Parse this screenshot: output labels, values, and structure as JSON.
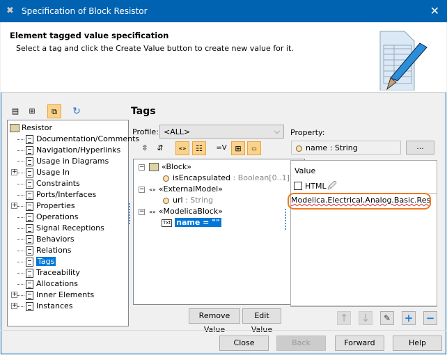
{
  "window": {
    "title": "Specification of Block Resistor",
    "close": "✕"
  },
  "header": {
    "title": "Element tagged value specification",
    "subtitle": "Select a tag and click the Create Value button to create new value for it."
  },
  "left_tree": {
    "root": "Resistor",
    "items": [
      {
        "label": "Documentation/Comments",
        "expandable": false
      },
      {
        "label": "Navigation/Hyperlinks",
        "expandable": false
      },
      {
        "label": "Usage in Diagrams",
        "expandable": false
      },
      {
        "label": "Usage In",
        "expandable": true
      },
      {
        "label": "Constraints",
        "expandable": false
      },
      {
        "label": "Ports/Interfaces",
        "expandable": false
      },
      {
        "label": "Properties",
        "expandable": true
      },
      {
        "label": "Operations",
        "expandable": false
      },
      {
        "label": "Signal Receptions",
        "expandable": false
      },
      {
        "label": "Behaviors",
        "expandable": false
      },
      {
        "label": "Relations",
        "expandable": false
      },
      {
        "label": "Tags",
        "expandable": false,
        "selected": true
      },
      {
        "label": "Traceability",
        "expandable": false
      },
      {
        "label": "Allocations",
        "expandable": false
      },
      {
        "label": "Inner Elements",
        "expandable": true
      },
      {
        "label": "Instances",
        "expandable": true
      }
    ]
  },
  "tags": {
    "title": "Tags",
    "profile_label": "Profile:",
    "profile_value": "<ALL>",
    "tree": [
      {
        "label": "«Block»"
      },
      {
        "name": "isEncapsulated",
        "type": " : Boolean[0..1]"
      },
      {
        "label": "«ExternalModel»"
      },
      {
        "name": "url",
        "type": " : String"
      },
      {
        "label": "«ModelicaBlock»"
      },
      {
        "name": "name = \"\"",
        "icon": "Txt"
      }
    ],
    "remove_value": "Remove Value",
    "edit_value": "Edit Value"
  },
  "property": {
    "label": "Property:",
    "value": "name : String",
    "browse": "..."
  },
  "value": {
    "header": "Value",
    "html_label": "HTML",
    "html_checked": false,
    "text": "Modelica.Electrical.Analog.Basic.Resistor",
    "highlight_color": "#f07820"
  },
  "footer": {
    "close": "Close",
    "back": "Back",
    "forward": "Forward",
    "help": "Help"
  },
  "colors": {
    "titlebar": "#0063b1",
    "selection": "#0078d7",
    "toggle": "#fbd28a"
  }
}
